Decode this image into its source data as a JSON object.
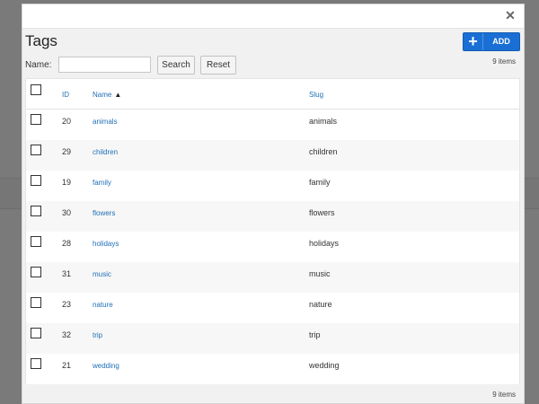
{
  "modal": {
    "title": "Tags",
    "close_icon": "close-icon",
    "add_button_label": "ADD",
    "add_icon": "plus-icon",
    "item_count_top": "9 items",
    "item_count_bottom": "9 items",
    "accent_color": "#1a6fd4"
  },
  "filter": {
    "name_label": "Name:",
    "name_value": "",
    "search_label": "Search",
    "reset_label": "Reset"
  },
  "table": {
    "columns": {
      "id": "ID",
      "name": "Name",
      "slug": "Slug"
    },
    "sort": {
      "column": "name",
      "direction": "ascending",
      "icon": "sort-up-icon"
    },
    "rows": [
      {
        "id": "20",
        "name": "animals",
        "slug": "animals"
      },
      {
        "id": "29",
        "name": "children",
        "slug": "children"
      },
      {
        "id": "19",
        "name": "family",
        "slug": "family"
      },
      {
        "id": "30",
        "name": "flowers",
        "slug": "flowers"
      },
      {
        "id": "28",
        "name": "holidays",
        "slug": "holidays"
      },
      {
        "id": "31",
        "name": "music",
        "slug": "music"
      },
      {
        "id": "23",
        "name": "nature",
        "slug": "nature"
      },
      {
        "id": "32",
        "name": "trip",
        "slug": "trip"
      },
      {
        "id": "21",
        "name": "wedding",
        "slug": "wedding"
      }
    ]
  }
}
